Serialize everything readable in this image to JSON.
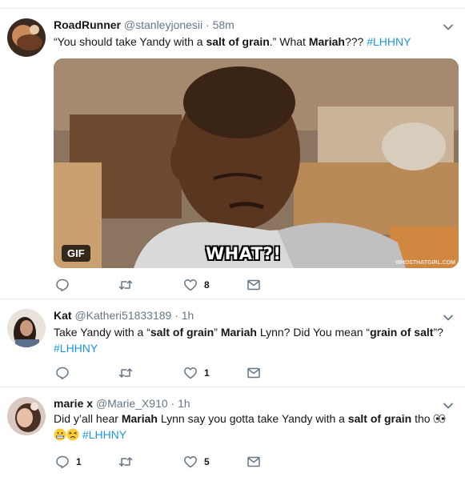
{
  "tweets": [
    {
      "name": "RoadRunner",
      "handle": "@stanleyjonesii",
      "sep": "·",
      "time": "58m",
      "text": [
        {
          "t": "“You should take Yandy with a "
        },
        {
          "t": "salt of grain",
          "bold": true
        },
        {
          "t": ".” What "
        },
        {
          "t": "Mariah",
          "bold": true
        },
        {
          "t": "??? "
        },
        {
          "t": "#LHHNY",
          "tag": true
        }
      ],
      "media": {
        "badge": "GIF",
        "caption": "WHAT?!",
        "watermark": "WHOSTHATGIRL.COM"
      },
      "actions": {
        "reply": "",
        "retweet": "",
        "like": "8"
      }
    },
    {
      "name": "Kat",
      "handle": "@Katheri51833189",
      "sep": "·",
      "time": "1h",
      "text": [
        {
          "t": "Take Yandy with a “"
        },
        {
          "t": "salt of grain",
          "bold": true
        },
        {
          "t": "” "
        },
        {
          "t": "Mariah",
          "bold": true
        },
        {
          "t": " Lynn? Did You mean “"
        },
        {
          "t": "grain of salt",
          "bold": true
        },
        {
          "t": "”? "
        },
        {
          "t": "#LHHNY",
          "tag": true
        }
      ],
      "actions": {
        "reply": "",
        "retweet": "",
        "like": "1"
      }
    },
    {
      "name": "marie x",
      "handle": "@Marie_X910",
      "sep": "·",
      "time": "1h",
      "text": [
        {
          "t": "Did y’all hear "
        },
        {
          "t": "Mariah",
          "bold": true
        },
        {
          "t": " Lynn say you gotta take Yandy with a "
        },
        {
          "t": "salt of grain",
          "bold": true
        },
        {
          "t": " tho "
        },
        {
          "emoji": "eyes-emoji"
        },
        {
          "t": " "
        },
        {
          "emoji": "grimacing-emoji"
        },
        {
          "emoji": "persevering-emoji"
        },
        {
          "t": " "
        },
        {
          "t": "#LHHNY",
          "tag": true
        }
      ],
      "actions": {
        "reply": "1",
        "retweet": "",
        "like": "5"
      }
    }
  ],
  "colors": {
    "link": "#1b95e0",
    "muted": "#657786",
    "text": "#14171a",
    "border": "#e6ecf0"
  },
  "icons": [
    "reply-icon",
    "retweet-icon",
    "heart-icon",
    "message-icon",
    "chevron-down-icon"
  ]
}
